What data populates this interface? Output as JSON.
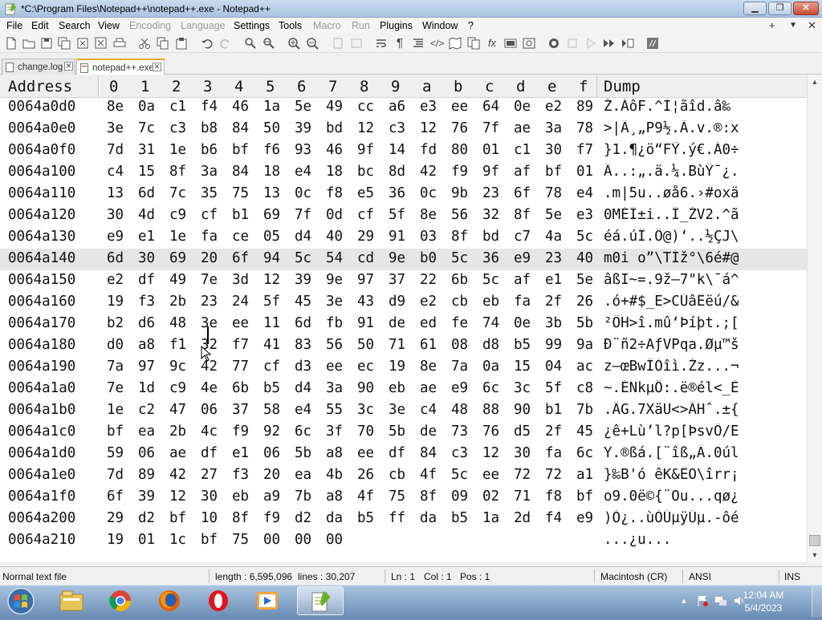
{
  "window": {
    "title": "*C:\\Program Files\\Notepad++\\notepad++.exe - Notepad++",
    "min_label": "▁",
    "max_label": "❐",
    "close_label": "✕"
  },
  "menu": {
    "items": [
      {
        "label": "File",
        "enabled": true
      },
      {
        "label": "Edit",
        "enabled": true
      },
      {
        "label": "Search",
        "enabled": true
      },
      {
        "label": "View",
        "enabled": true
      },
      {
        "label": "Encoding",
        "enabled": false
      },
      {
        "label": "Language",
        "enabled": false
      },
      {
        "label": "Settings",
        "enabled": true
      },
      {
        "label": "Tools",
        "enabled": true
      },
      {
        "label": "Macro",
        "enabled": false
      },
      {
        "label": "Run",
        "enabled": false
      },
      {
        "label": "Plugins",
        "enabled": true
      },
      {
        "label": "Window",
        "enabled": true
      },
      {
        "label": "?",
        "enabled": true
      }
    ],
    "right": {
      "add": "+",
      "list": "▼",
      "close": "✕"
    }
  },
  "tabs": [
    {
      "label": "change.log",
      "active": false
    },
    {
      "label": "notepad++.exe",
      "active": true
    }
  ],
  "hex": {
    "headers": {
      "address": "Address",
      "columns": [
        "0",
        "1",
        "2",
        "3",
        "4",
        "5",
        "6",
        "7",
        "8",
        "9",
        "a",
        "b",
        "c",
        "d",
        "e",
        "f"
      ],
      "dump": "Dump"
    },
    "rows": [
      {
        "address": "0064a0d0",
        "bytes": [
          "8e",
          "0a",
          "c1",
          "f4",
          "46",
          "1a",
          "5e",
          "49",
          "cc",
          "a6",
          "e3",
          "ee",
          "64",
          "0e",
          "e2",
          "89"
        ],
        "dump": "Ž.ÁôF.^Ì¦ãîd.â‰"
      },
      {
        "address": "0064a0e0",
        "bytes": [
          "3e",
          "7c",
          "c3",
          "b8",
          "84",
          "50",
          "39",
          "bd",
          "12",
          "c3",
          "12",
          "76",
          "7f",
          "ae",
          "3a",
          "78"
        ],
        "dump": ">|Ã¸„P9½.Ã.v.®:x"
      },
      {
        "address": "0064a0f0",
        "bytes": [
          "7d",
          "31",
          "1e",
          "b6",
          "bf",
          "f6",
          "93",
          "46",
          "9f",
          "14",
          "fd",
          "80",
          "01",
          "c1",
          "30",
          "f7"
        ],
        "dump": "}1.¶¿ö“FŸ.ý€.Á0÷"
      },
      {
        "address": "0064a100",
        "bytes": [
          "c4",
          "15",
          "8f",
          "3a",
          "84",
          "18",
          "e4",
          "18",
          "bc",
          "8d",
          "42",
          "f9",
          "9f",
          "af",
          "bf",
          "01"
        ],
        "dump": "Ä..:„.ä.¼.BùŸ¯¿."
      },
      {
        "address": "0064a110",
        "bytes": [
          "13",
          "6d",
          "7c",
          "35",
          "75",
          "13",
          "0c",
          "f8",
          "e5",
          "36",
          "0c",
          "9b",
          "23",
          "6f",
          "78",
          "e4"
        ],
        "dump": ".m|5u..øå6.›#oxä"
      },
      {
        "address": "0064a120",
        "bytes": [
          "30",
          "4d",
          "c9",
          "cf",
          "b1",
          "69",
          "7f",
          "0d",
          "cf",
          "5f",
          "8e",
          "56",
          "32",
          "8f",
          "5e",
          "e3"
        ],
        "dump": "0MÉÏ±i..Ï_ŽV2.^ã"
      },
      {
        "address": "0064a130",
        "bytes": [
          "e9",
          "e1",
          "1e",
          "fa",
          "ce",
          "05",
          "d4",
          "40",
          "29",
          "91",
          "03",
          "8f",
          "bd",
          "c7",
          "4a",
          "5c"
        ],
        "dump": "éá.úÎ.Ô@)‘..½ÇJ\\"
      },
      {
        "address": "0064a140",
        "bytes": [
          "6d",
          "30",
          "69",
          "20",
          "6f",
          "94",
          "5c",
          "54",
          "cd",
          "9e",
          "b0",
          "5c",
          "36",
          "e9",
          "23",
          "40"
        ],
        "dump": "m0i o”\\TÍž°\\6é#@",
        "selected": true
      },
      {
        "address": "0064a150",
        "bytes": [
          "e2",
          "df",
          "49",
          "7e",
          "3d",
          "12",
          "39",
          "9e",
          "97",
          "37",
          "22",
          "6b",
          "5c",
          "af",
          "e1",
          "5e"
        ],
        "dump": "âßI~=.9ž—7\"k\\¯á^"
      },
      {
        "address": "0064a160",
        "bytes": [
          "19",
          "f3",
          "2b",
          "23",
          "24",
          "5f",
          "45",
          "3e",
          "43",
          "d9",
          "e2",
          "cb",
          "eb",
          "fa",
          "2f",
          "26"
        ],
        "dump": ".ó+#$_E>CÙâËëú/&"
      },
      {
        "address": "0064a170",
        "bytes": [
          "b2",
          "d6",
          "48",
          "3e",
          "ee",
          "11",
          "6d",
          "fb",
          "91",
          "de",
          "ed",
          "fe",
          "74",
          "0e",
          "3b",
          "5b"
        ],
        "dump": "²ÖH>î.mû‘Þíþt.;["
      },
      {
        "address": "0064a180",
        "bytes": [
          "d0",
          "a8",
          "f1",
          "32",
          "f7",
          "41",
          "83",
          "56",
          "50",
          "71",
          "61",
          "08",
          "d8",
          "b5",
          "99",
          "9a"
        ],
        "dump": "Ð¨ñ2÷AƒVPqa.Øµ™š"
      },
      {
        "address": "0064a190",
        "bytes": [
          "7a",
          "97",
          "9c",
          "42",
          "77",
          "cf",
          "d3",
          "ee",
          "ec",
          "19",
          "8e",
          "7a",
          "0a",
          "15",
          "04",
          "ac"
        ],
        "dump": "z—œBwÏÓîì.Žz...¬"
      },
      {
        "address": "0064a1a0",
        "bytes": [
          "7e",
          "1d",
          "c9",
          "4e",
          "6b",
          "b5",
          "d4",
          "3a",
          "90",
          "eb",
          "ae",
          "e9",
          "6c",
          "3c",
          "5f",
          "c8"
        ],
        "dump": "~.ÉNkµÔ:.ë®él<_È"
      },
      {
        "address": "0064a1b0",
        "bytes": [
          "1e",
          "c2",
          "47",
          "06",
          "37",
          "58",
          "e4",
          "55",
          "3c",
          "3e",
          "c4",
          "48",
          "88",
          "90",
          "b1",
          "7b"
        ],
        "dump": ".ÂG.7XäU<>ÄHˆ.±{"
      },
      {
        "address": "0064a1c0",
        "bytes": [
          "bf",
          "ea",
          "2b",
          "4c",
          "f9",
          "92",
          "6c",
          "3f",
          "70",
          "5b",
          "de",
          "73",
          "76",
          "d5",
          "2f",
          "45"
        ],
        "dump": "¿ê+Lù’l?p[ÞsvÕ/E"
      },
      {
        "address": "0064a1d0",
        "bytes": [
          "59",
          "06",
          "ae",
          "df",
          "e1",
          "06",
          "5b",
          "a8",
          "ee",
          "df",
          "84",
          "c3",
          "12",
          "30",
          "fa",
          "6c"
        ],
        "dump": "Y.®ßá.[¨îß„Ã.0úl"
      },
      {
        "address": "0064a1e0",
        "bytes": [
          "7d",
          "89",
          "42",
          "27",
          "f3",
          "20",
          "ea",
          "4b",
          "26",
          "cb",
          "4f",
          "5c",
          "ee",
          "72",
          "72",
          "a1"
        ],
        "dump": "}‰B'ó êK&ËO\\îrr¡"
      },
      {
        "address": "0064a1f0",
        "bytes": [
          "6f",
          "39",
          "12",
          "30",
          "eb",
          "a9",
          "7b",
          "a8",
          "4f",
          "75",
          "8f",
          "09",
          "02",
          "71",
          "f8",
          "bf"
        ],
        "dump": "o9.0ë©{¨Ou...qø¿"
      },
      {
        "address": "0064a200",
        "bytes": [
          "29",
          "d2",
          "bf",
          "10",
          "8f",
          "f9",
          "d2",
          "da",
          "b5",
          "ff",
          "da",
          "b5",
          "1a",
          "2d",
          "f4",
          "e9"
        ],
        "dump": ")Ò¿..ùÒÚµÿÚµ.-ôé"
      },
      {
        "address": "0064a210",
        "bytes": [
          "19",
          "01",
          "1c",
          "bf",
          "75",
          "00",
          "00",
          "00"
        ],
        "dump": "...¿u..."
      }
    ]
  },
  "status": {
    "file_type": "Normal text file",
    "length": "length : 6,595,096",
    "lines": "lines : 30,207",
    "ln": "Ln : 1",
    "col": "Col : 1",
    "pos": "Pos : 1",
    "eol": "Macintosh (CR)",
    "encoding": "ANSI",
    "mode": "INS"
  },
  "taskbar": {
    "time": "12:04 AM",
    "date": "5/4/2023"
  }
}
